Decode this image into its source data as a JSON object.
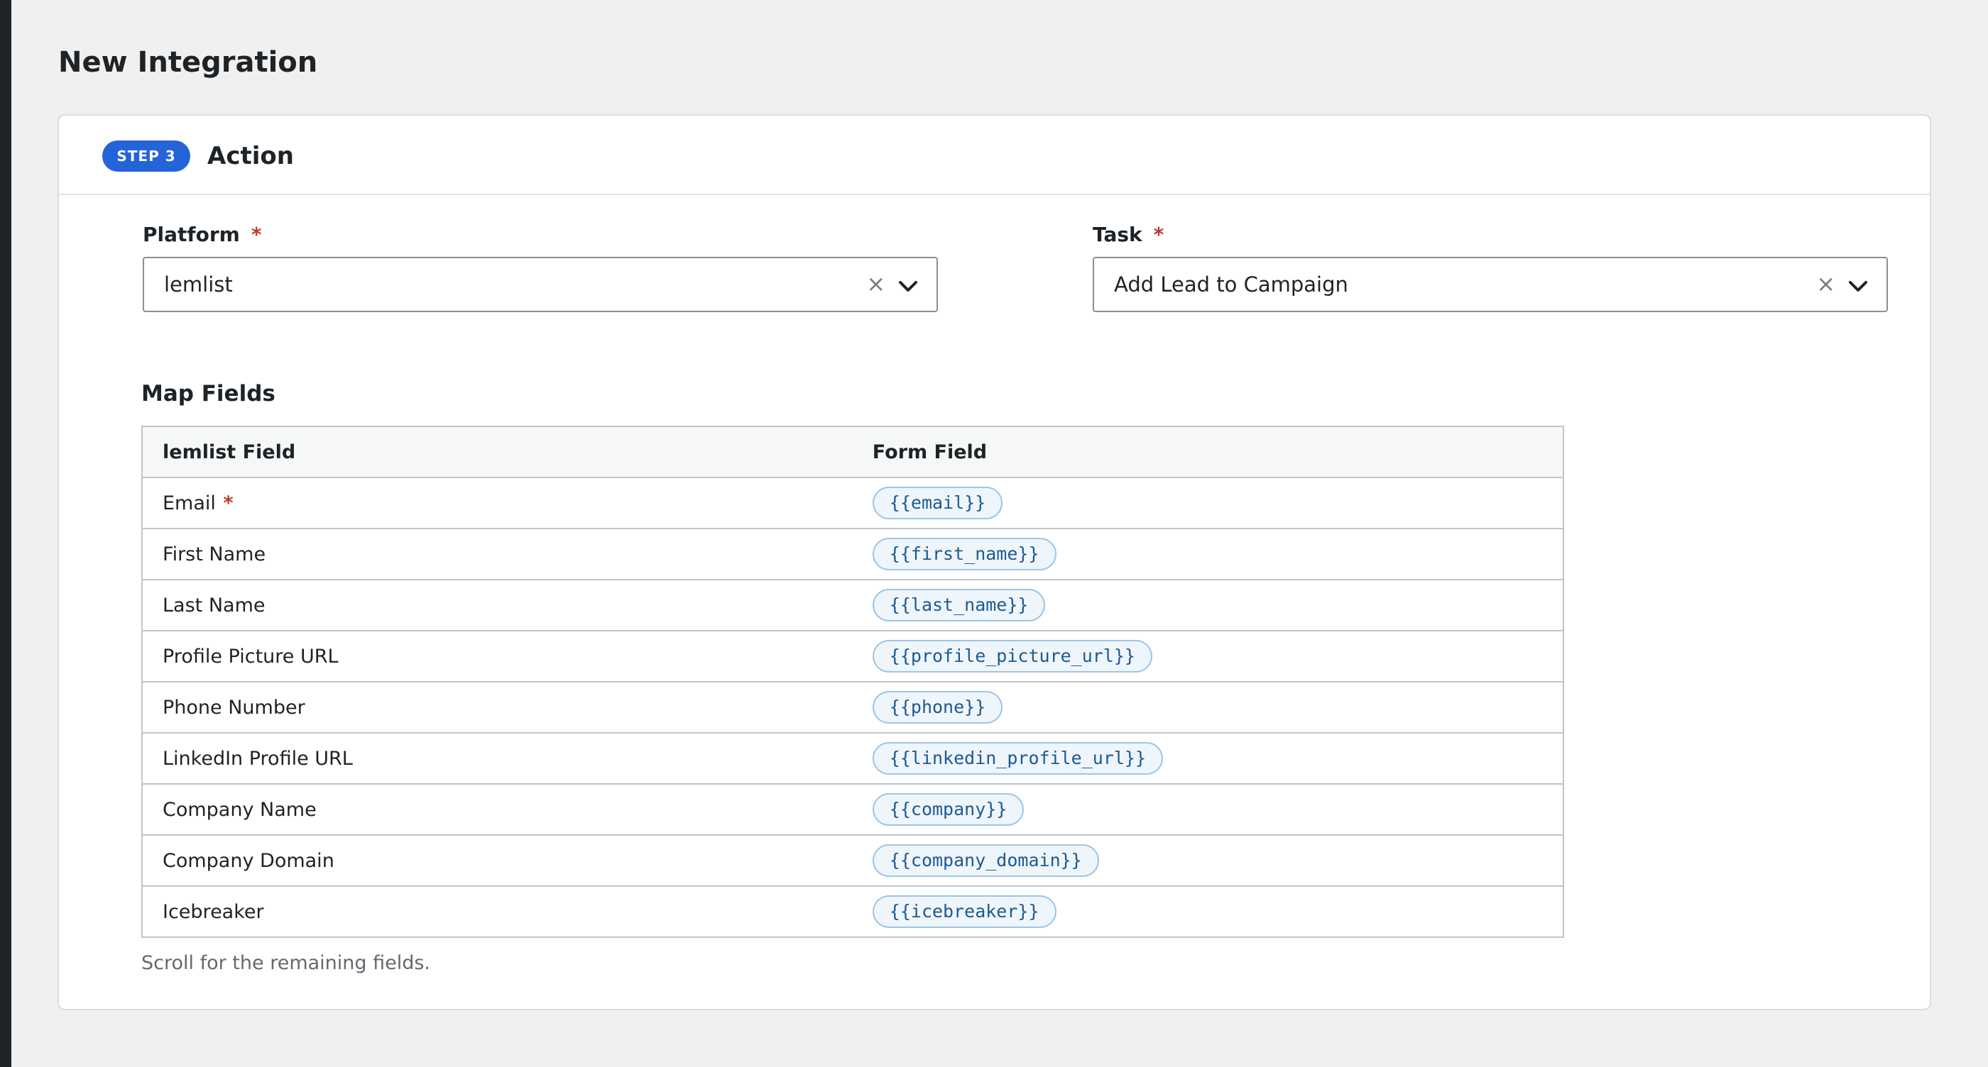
{
  "page": {
    "title": "New Integration"
  },
  "step": {
    "badge": "STEP 3",
    "title": "Action"
  },
  "platform": {
    "label": "Platform",
    "required_mark": "*",
    "value": "lemlist",
    "clear_glyph": "×",
    "chevron_icon": "chevron-down-icon"
  },
  "task": {
    "label": "Task",
    "required_mark": "*",
    "value": "Add Lead to Campaign",
    "clear_glyph": "×",
    "chevron_icon": "chevron-down-icon"
  },
  "map_fields": {
    "title": "Map Fields",
    "columns": [
      "lemlist Field",
      "Form Field"
    ],
    "rows": [
      {
        "field": "Email",
        "required_mark": "*",
        "token": "{{email}}"
      },
      {
        "field": "First Name",
        "token": "{{first_name}}"
      },
      {
        "field": "Last Name",
        "token": "{{last_name}}"
      },
      {
        "field": "Profile Picture URL",
        "token": "{{profile_picture_url}}"
      },
      {
        "field": "Phone Number",
        "token": "{{phone}}"
      },
      {
        "field": "LinkedIn Profile URL",
        "token": "{{linkedin_profile_url}}"
      },
      {
        "field": "Company Name",
        "token": "{{company}}"
      },
      {
        "field": "Company Domain",
        "token": "{{company_domain}}"
      },
      {
        "field": "Icebreaker",
        "token": "{{icebreaker}}"
      }
    ],
    "note": "Scroll for the remaining fields."
  },
  "colors": {
    "accent": "#2563d9",
    "required": "#c0392b",
    "token_bg": "#eef5fb",
    "token_text": "#1e5a8f"
  }
}
